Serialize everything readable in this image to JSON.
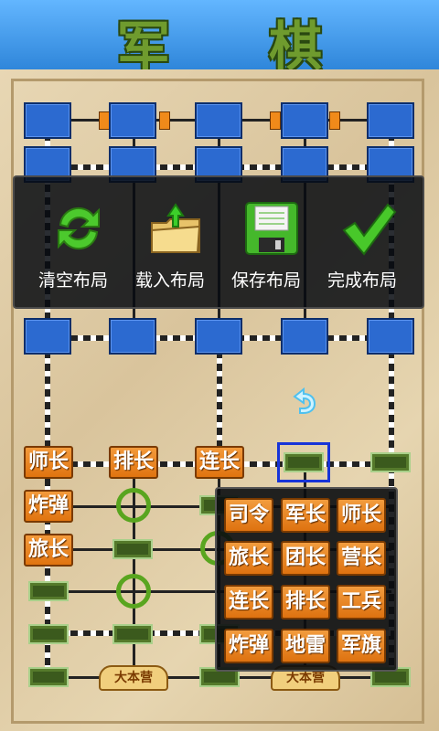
{
  "title": "军 棋",
  "board": {
    "pieces": [
      {
        "label": "师长"
      },
      {
        "label": "排长"
      },
      {
        "label": "连长"
      },
      {
        "label": "炸弹"
      },
      {
        "label": "旅长"
      }
    ],
    "hq_left": "大本营",
    "hq_right": "大本营"
  },
  "menu": {
    "items": [
      {
        "label": "清空布局",
        "icon": "refresh-icon"
      },
      {
        "label": "载入布局",
        "icon": "folder-upload-icon"
      },
      {
        "label": "保存布局",
        "icon": "floppy-disk-icon"
      },
      {
        "label": "完成布局",
        "icon": "checkmark-icon"
      }
    ]
  },
  "picker": {
    "pieces": [
      "司令",
      "军长",
      "师长",
      "旅长",
      "团长",
      "营长",
      "连长",
      "排长",
      "工兵",
      "炸弹",
      "地雷",
      "军旗"
    ]
  },
  "colors": {
    "title_green": "#6f9b2e",
    "board_bg": "#e3d0a9",
    "enemy_blue": "#2c6ad0",
    "piece_orange": "#e98420",
    "camp_green": "#59a51f",
    "station_green": "#3b5a1d",
    "selection_blue": "#1834d8"
  }
}
